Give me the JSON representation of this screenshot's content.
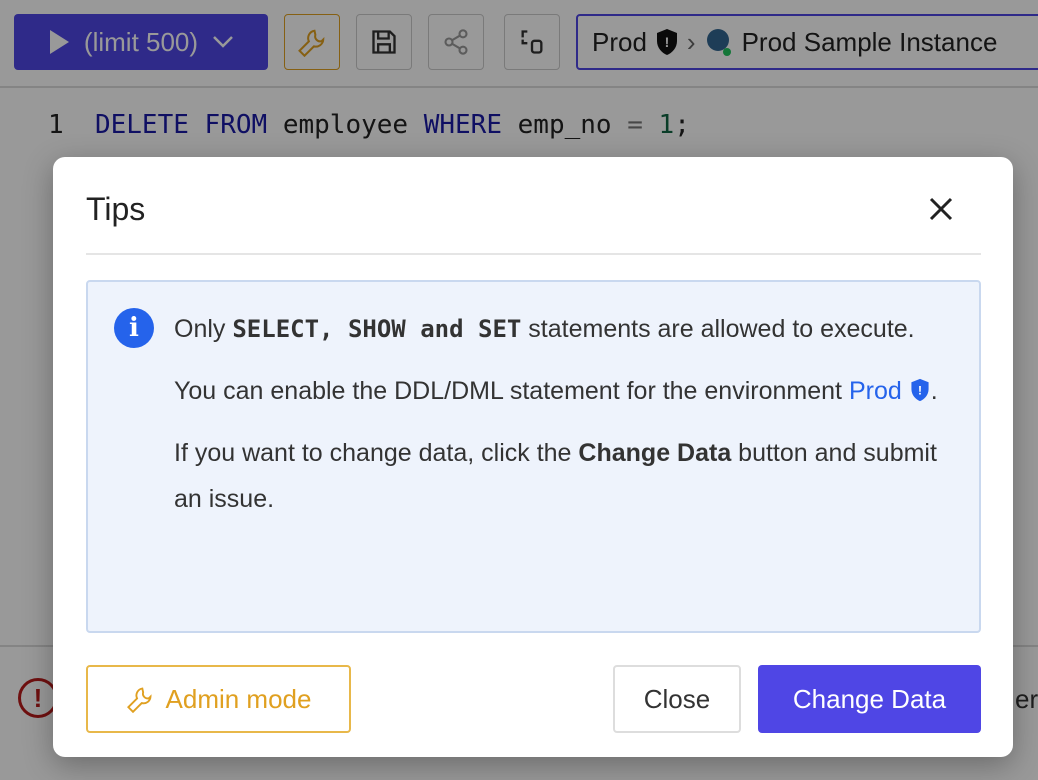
{
  "toolbar": {
    "run_label": "(limit 500)",
    "env": "Prod",
    "instance": "Prod Sample Instance"
  },
  "editor": {
    "line_number": "1",
    "kw1": "DELETE",
    "kw2": "FROM",
    "table": "employee",
    "kw3": "WHERE",
    "col": "emp_no",
    "op": "=",
    "val": "1",
    "semi": ";"
  },
  "bottom": {
    "partial_text": "er"
  },
  "modal": {
    "title": "Tips",
    "p1_a": "Only ",
    "p1_b": "SELECT, SHOW and SET",
    "p1_c": " statements are allowed to execute.",
    "p2_a": "You can enable the DDL/DML statement for the environment ",
    "p2_link": "Prod",
    "p2_c": ".",
    "p3_a": "If you want to change data, click the ",
    "p3_b": "Change Data",
    "p3_c": " button and submit an issue.",
    "admin_label": "Admin mode",
    "close_label": "Close",
    "change_label": "Change Data"
  },
  "colors": {
    "accent": "#4f46e5",
    "info": "#2563eb",
    "admin": "#e0a020",
    "error": "#b91c1c"
  }
}
